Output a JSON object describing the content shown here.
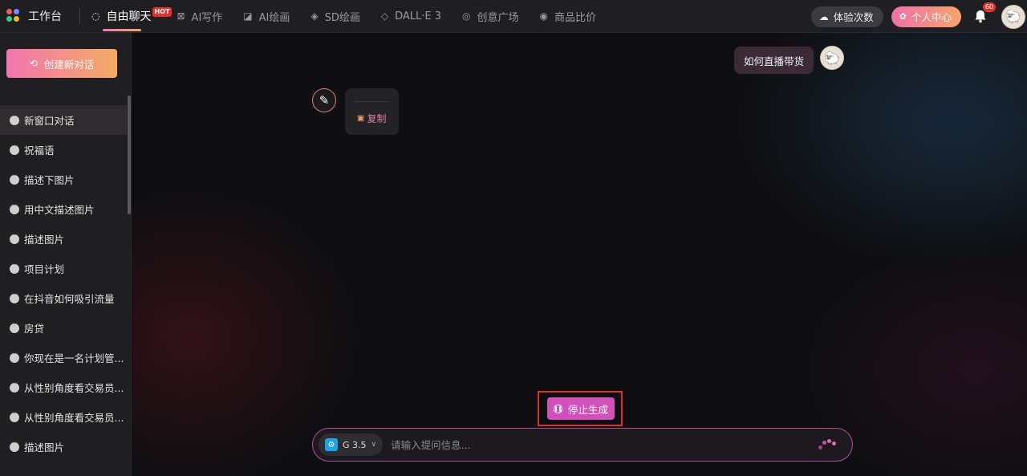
{
  "app": {
    "title": "工作台"
  },
  "nav": {
    "items": [
      {
        "label": "自由聊天",
        "icon": "chat-bubble-icon",
        "hot": "HOT"
      },
      {
        "label": "AI写作",
        "icon": "grid-icon"
      },
      {
        "label": "AI绘画",
        "icon": "brush-icon"
      },
      {
        "label": "SD绘画",
        "icon": "paint-icon"
      },
      {
        "label": "DALL·E 3",
        "icon": "layers-icon"
      },
      {
        "label": "创意广场",
        "icon": "compass-icon"
      },
      {
        "label": "商品比价",
        "icon": "tag-icon"
      }
    ]
  },
  "header": {
    "experience_label": "体验次数",
    "user_center_label": "个人中心",
    "notification_count": "60"
  },
  "sidebar": {
    "new_chat_label": "创建新对话",
    "items": [
      "新窗口对话",
      "祝福语",
      "描述下图片",
      "用中文描述图片",
      "描述图片",
      "项目计划",
      "在抖音如何吸引流量",
      "房贷",
      "你现在是一名计划管...",
      "从性别角度看交易员...",
      "从性别角度看交易员...",
      "描述图片"
    ]
  },
  "chat": {
    "user_message": "如何直播带货",
    "copy_label": "复制",
    "stop_label": "停止生成"
  },
  "input": {
    "model_label": "G 3.5",
    "placeholder": "请输入提问信息..."
  },
  "colors": {
    "accent_start": "#f274ae",
    "accent_end": "#f5ab66",
    "stop_button": "#d34fb9",
    "highlight_border": "#d8342c"
  }
}
